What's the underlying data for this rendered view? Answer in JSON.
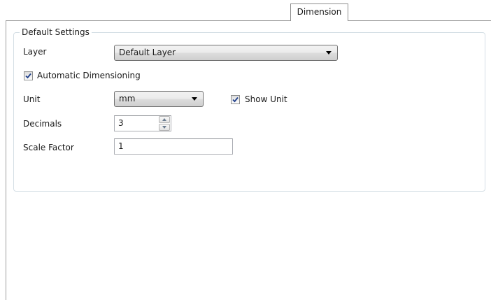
{
  "tab": {
    "label": "Dimension"
  },
  "group": {
    "title": "Default Settings"
  },
  "layer": {
    "label": "Layer",
    "value": "Default Layer",
    "icon": "chevron-down-icon"
  },
  "automatic_dimensioning": {
    "label": "Automatic Dimensioning",
    "checked": true
  },
  "unit": {
    "label": "Unit",
    "value": "mm",
    "icon": "chevron-down-icon"
  },
  "show_unit": {
    "label": "Show Unit",
    "checked": true
  },
  "decimals": {
    "label": "Decimals",
    "value": "3"
  },
  "scale_factor": {
    "label": "Scale Factor",
    "value": "1"
  },
  "colors": {
    "accent_check": "#1f3f8a",
    "group_border": "#d5dfe5"
  }
}
